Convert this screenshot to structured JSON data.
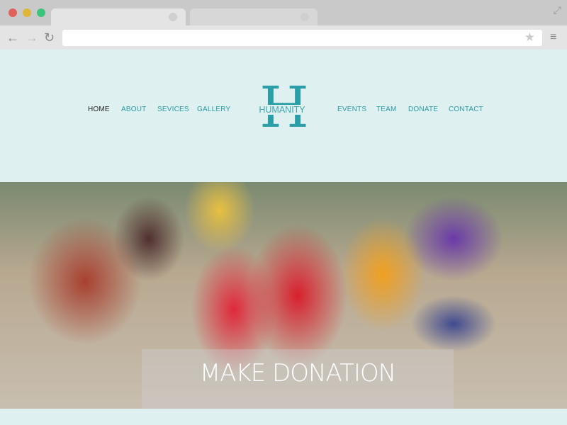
{
  "browser": {
    "traffic_lights": [
      "#e0605c",
      "#e0b63a",
      "#3cc47a"
    ],
    "tabs": [
      {
        "label": ""
      },
      {
        "label": ""
      }
    ],
    "url": "",
    "icons": [
      "back-icon",
      "forward-icon",
      "reload-icon",
      "star-icon",
      "menu-icon",
      "fullscreen-icon"
    ]
  },
  "nav": {
    "left": [
      {
        "label": "HOME",
        "active": true
      },
      {
        "label": "ABOUT"
      },
      {
        "label": "SEVICES"
      },
      {
        "label": "GALLERY"
      }
    ],
    "right": [
      {
        "label": "EVENTS"
      },
      {
        "label": "TEAM"
      },
      {
        "label": "DONATE"
      },
      {
        "label": "CONTACT"
      }
    ]
  },
  "logo": {
    "letter": "H",
    "text": "HUMANITY"
  },
  "hero": {
    "cta": "MAKE DONATION"
  },
  "colors": {
    "accent": "#2b9ea7",
    "header_bg": "#dff0f0"
  }
}
